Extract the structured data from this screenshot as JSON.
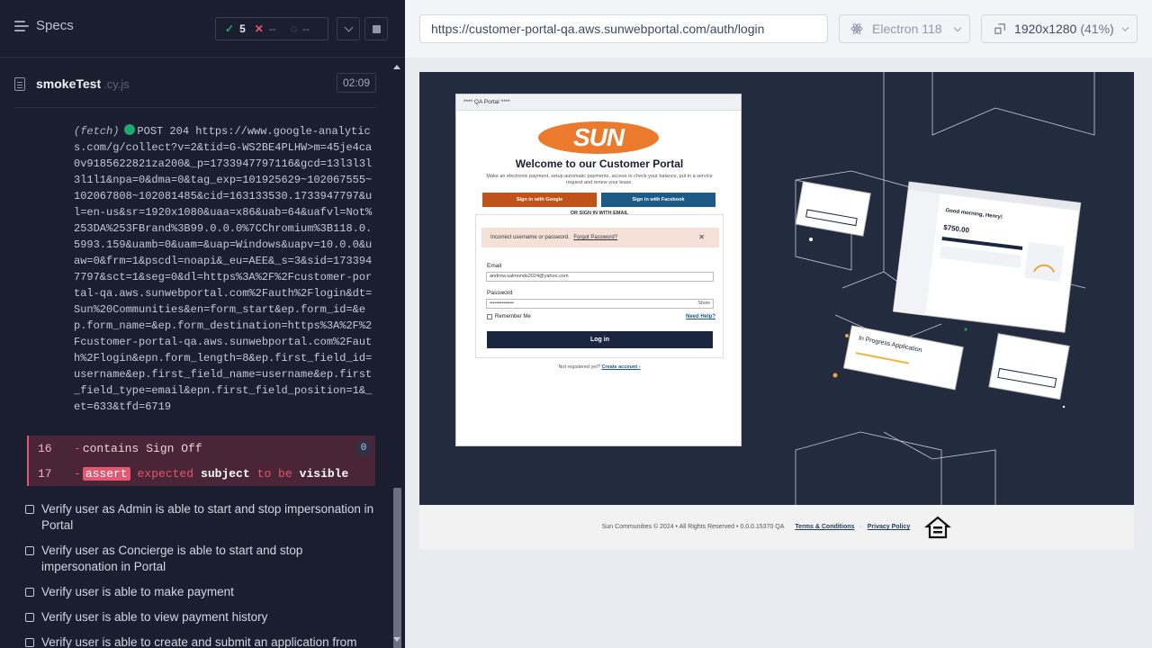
{
  "reporter": {
    "specs_label": "Specs",
    "stats": {
      "passed": "5",
      "failed": "--",
      "pending": "--"
    },
    "spec_file": {
      "name": "smokeTest",
      "ext": ".cy.js",
      "duration": "02:09"
    },
    "log": {
      "type": "(fetch)",
      "text": "POST 204 https://www.google-analytics.com/g/collect?v=2&tid=G-WS2BE4PLHW>m=45je4ca0v9185622821za200&_p=1733947797116&gcd=13l3l3l3l1l1&npa=0&dma=0&tag_exp=101925629~102067555~102067808~102081485&cid=163133530.1733947797&ul=en-us&sr=1920x1080&uaa=x86&uab=64&uafvl=Not%253DA%253FBrand%3B99.0.0.0%7CChromium%3B118.0.5993.159&uamb=0&uam=&uap=Windows&uapv=10.0.0&uaw=0&frm=1&pscdl=noapi&_eu=AEE&_s=3&sid=1733947797&sct=1&seg=0&dl=https%3A%2F%2Fcustomer-portal-qa.aws.sunwebportal.com%2Fauth%2Flogin&dt=Sun%20Communities&en=form_start&ep.form_id=&ep.form_name=&ep.form_destination=https%3A%2F%2Fcustomer-portal-qa.aws.sunwebportal.com%2Fauth%2Flogin&epn.form_length=8&ep.first_field_id=username&ep.first_field_name=username&ep.first_field_type=email&epn.first_field_position=1&_et=633&tfd=6719"
    },
    "commands": [
      {
        "num": "16",
        "name": "contains",
        "msg": "Sign Off",
        "count": "0"
      },
      {
        "num": "17",
        "name": "assert",
        "msg_a": "expected",
        "msg_b": "subject",
        "msg_c": "to be",
        "msg_d": "visible"
      }
    ],
    "tests": [
      "Verify user as Admin is able to start and stop impersonation in Portal",
      "Verify user as Concierge is able to start and stop impersonation in Portal",
      "Verify user is able to make payment",
      "Verify user is able to view payment history",
      "Verify user is able to create and submit an application from Portal"
    ]
  },
  "aut": {
    "url": "https://customer-portal-qa.aws.sunwebportal.com/auth/login",
    "browser": "Electron 118",
    "viewport": "1920x1280",
    "zoom": "(41%)",
    "portal": {
      "tab_label": "**** QA Portal ****",
      "logo_text": "SUN",
      "title": "Welcome to our Customer Portal",
      "subtitle": "Make an electronic payment, setup automatic payments, access to check your balance, put in a service request and renew your lease.",
      "google_btn": "Sign in with Google",
      "facebook_btn": "Sign in with Facebook",
      "or_text": "OR SIGN IN WITH EMAIL",
      "error": "Incorrect username or password.",
      "error_link": "Forgot Password?",
      "email_label": "Email",
      "email_value": "andrew.salmonds2024@yahoo.com",
      "password_label": "Password",
      "password_value": "••••••••••••••",
      "show_label": "Show",
      "remember_label": "Remember Me",
      "help_link": "Need Help?",
      "login_btn": "Log in",
      "not_registered": "Not registered yet?",
      "create_account": "Create account ›",
      "footer_text": "Sun Communities © 2024 • All Rights Reserved • 0.0.0.15370 QA",
      "terms": "Terms & Conditions",
      "privacy": "Privacy Policy",
      "illus_card1_title": "In Progress Application",
      "illus_card2_title": "Good morning, Henry!",
      "illus_amount": "$750.00"
    }
  }
}
